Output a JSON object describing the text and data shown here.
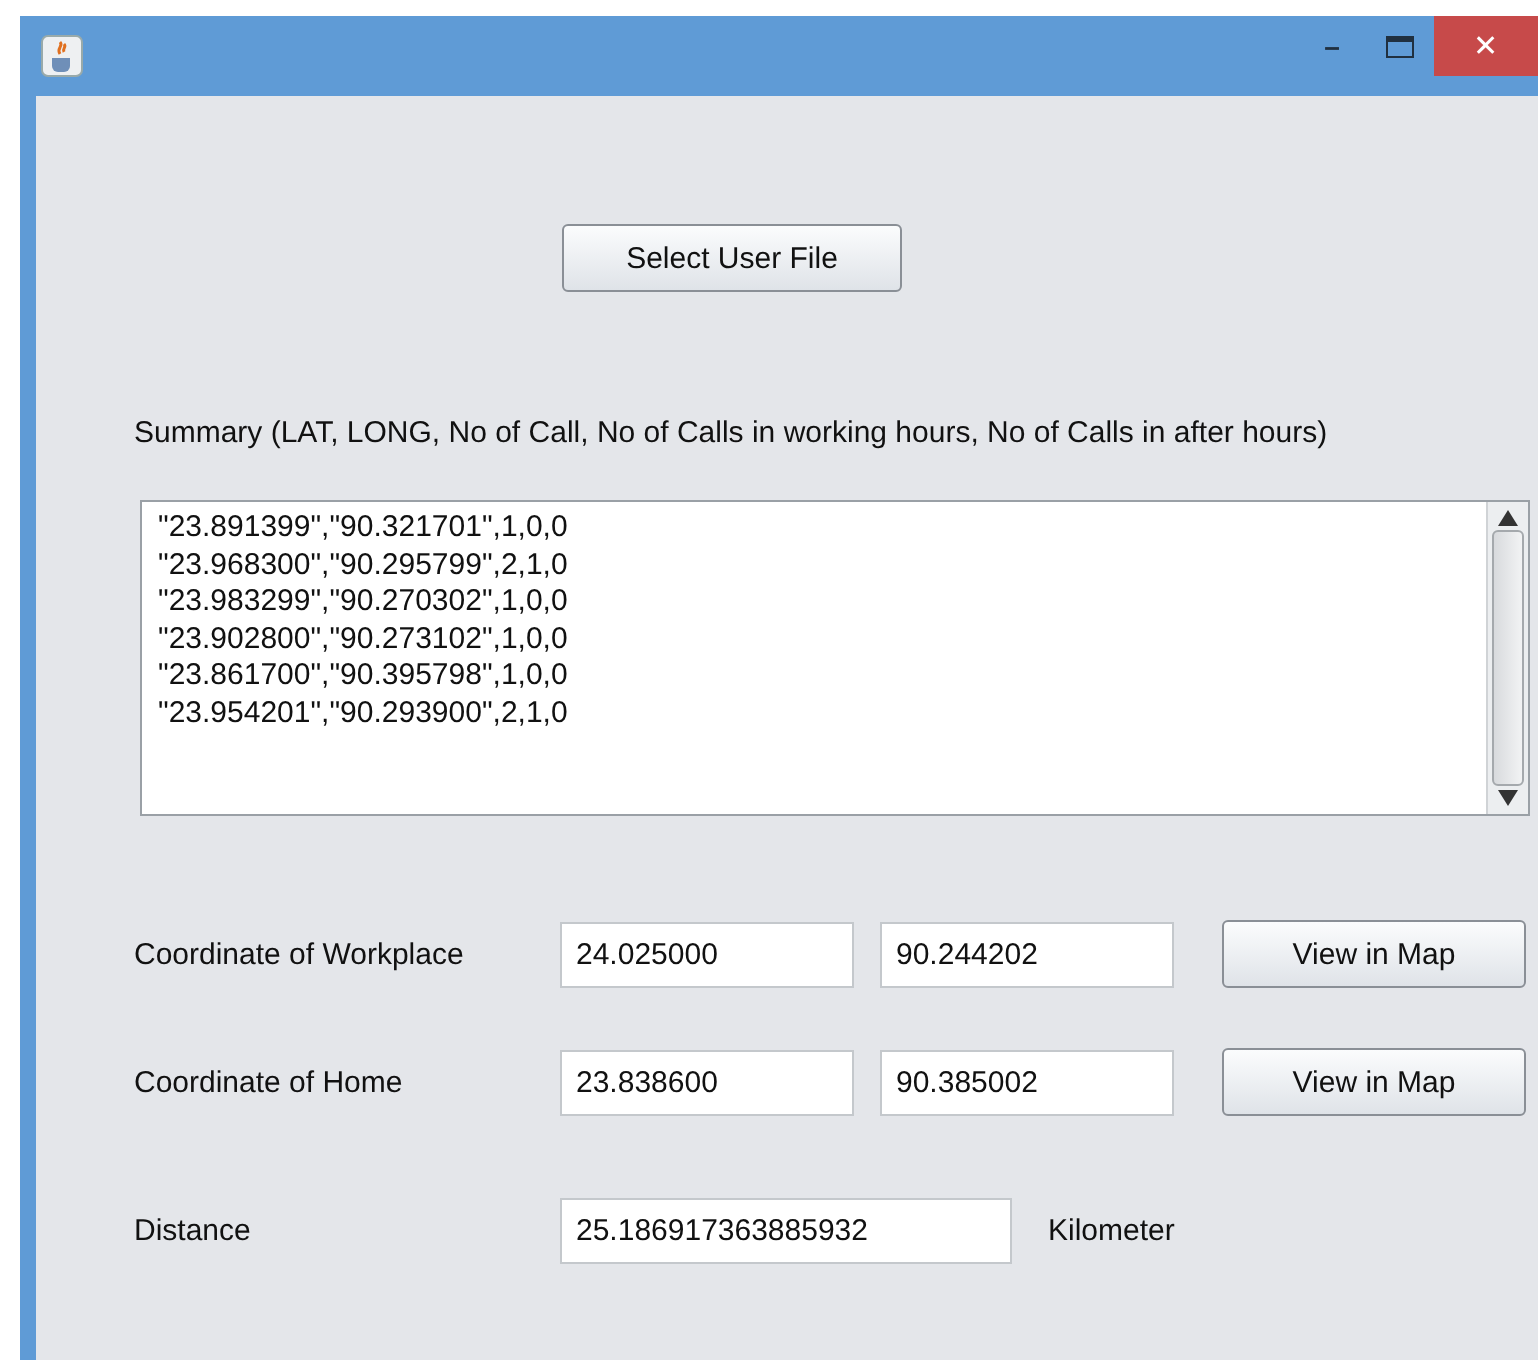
{
  "window": {
    "title_bar": {
      "minimize": "–",
      "close": "✕"
    }
  },
  "select_button": "Select User File",
  "summary_label": "Summary (LAT, LONG, No of Call, No of Calls in working hours, No of Calls in after hours)",
  "summary_lines": [
    "\"23.891399\",\"90.321701\",1,0,0",
    "\"23.968300\",\"90.295799\",2,1,0",
    "\"23.983299\",\"90.270302\",1,0,0",
    "\"23.902800\",\"90.273102\",1,0,0",
    "\"23.861700\",\"90.395798\",1,0,0",
    "\"23.954201\",\"90.293900\",2,1,0"
  ],
  "coordinates": [
    {
      "label": "Coordinate of Workplace",
      "lat": "24.025000",
      "long": "90.244202",
      "button": "View in Map"
    },
    {
      "label": "Coordinate of Home",
      "lat": "23.838600",
      "long": "90.385002",
      "button": "View in Map"
    }
  ],
  "distance": {
    "label": "Distance",
    "value": "25.186917363885932",
    "unit": "Kilometer"
  }
}
